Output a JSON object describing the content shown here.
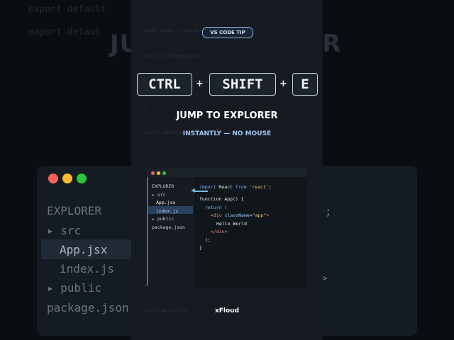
{
  "background": {
    "code_lines": [
      "export default",
      "export defaul"
    ],
    "heading_left": "JUMP",
    "heading_right": "ER",
    "tree": [
      "EXPLORER",
      "▸ src",
      "App.jsx",
      "index.js",
      "▸ public",
      "package.json"
    ],
    "right_glyphs": [
      ";",
      ">"
    ]
  },
  "ghost_code": [
    "const editor = vscode.window",
    "function focusExplorer() {",
    "  return commands.execute",
    "}",
    "editor.onDidChangeActive",
    "",
    "",
    "",
    "",
    "",
    "export default App",
    "import React from"
  ],
  "badge": "VS CODE TIP",
  "keys": [
    "CTRL",
    "SHIFT",
    "E"
  ],
  "plus": "+",
  "title": "JUMP TO EXPLORER",
  "subtitle": "INSTANTLY — NO MOUSE",
  "mini_window": {
    "colors": {
      "close": "#ff5f57",
      "minimize": "#febc2e",
      "maximize": "#28c840",
      "accent": "#7ab3e0"
    },
    "sidebar": [
      "EXPLORER",
      "▸ src",
      "App.jsx",
      "index.js",
      "▸ public",
      "package.json"
    ],
    "code": {
      "l1_kw": "import",
      "l1_mid": " React ",
      "l1_kw2": "from",
      "l1_str": " 'react'",
      "l1_end": ";",
      "l2": "function App() {",
      "l3": "return (",
      "l4_open": "<div ",
      "l4_attr": "className",
      "l4_eq": "=",
      "l4_str": "\"app\"",
      "l4_close": ">",
      "l5": "Hello World",
      "l6": "</div>",
      "l7": ");",
      "l8": "}"
    }
  },
  "brand": "xFloud"
}
